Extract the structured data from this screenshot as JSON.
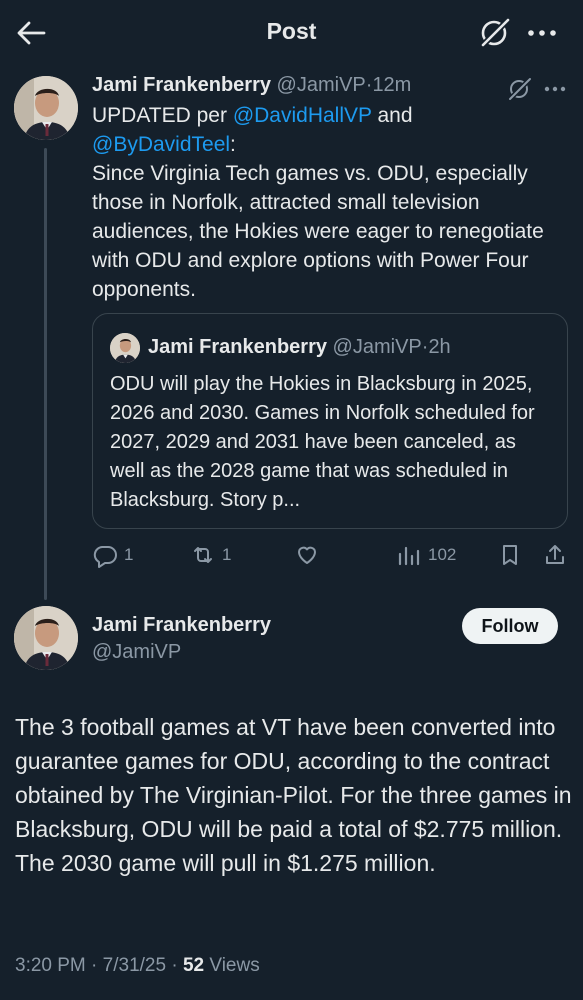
{
  "header": {
    "title": "Post",
    "back_icon": "arrow-left-icon",
    "grok_icon": "grok-icon",
    "more_icon": "more-horizontal-icon"
  },
  "reply_tweet": {
    "author_name": "Jami Frankenberry",
    "author_handle": "@JamiVP",
    "separator": "·",
    "time": "12m",
    "text_prefix": "UPDATED per ",
    "mention1": "@DavidHallVP",
    "text_and": " and",
    "mention2": "@ByDavidTeel",
    "text_colon": ":",
    "text_body": "Since Virginia Tech games vs. ODU, especially those in Norfolk, attracted small television audiences, the Hokies were eager to renegotiate with ODU and explore options with Power Four opponents."
  },
  "quote_tweet": {
    "author_name": "Jami Frankenberry",
    "author_handle": "@JamiVP",
    "separator": "·",
    "time": "2h",
    "text": "ODU will play the Hokies in Blacksburg in 2025, 2026 and 2030. Games in Norfolk scheduled for 2027, 2029 and 2031 have been canceled, as well as the 2028 game that was scheduled in Blacksburg. Story p..."
  },
  "actions": {
    "replies": "1",
    "reposts": "1",
    "likes": "",
    "views": "102"
  },
  "main_tweet": {
    "author_name": "Jami Frankenberry",
    "author_handle": "@JamiVP",
    "follow_label": "Follow",
    "text": "The 3 football games at VT have been converted into guarantee games for ODU, according to the contract  obtained by The Virginian-Pilot. For the three games in Blacksburg, ODU will be paid a total of $2.775 million. The 2030 game will pull in $1.275 million.",
    "time": "3:20 PM",
    "separator1": "·",
    "date": "7/31/25",
    "separator2": "·",
    "views_count": "52",
    "views_label": "Views"
  },
  "colors": {
    "background": "#15202b",
    "text": "#e7e9ea",
    "muted": "#8b98a5",
    "link": "#1d9bf0"
  }
}
